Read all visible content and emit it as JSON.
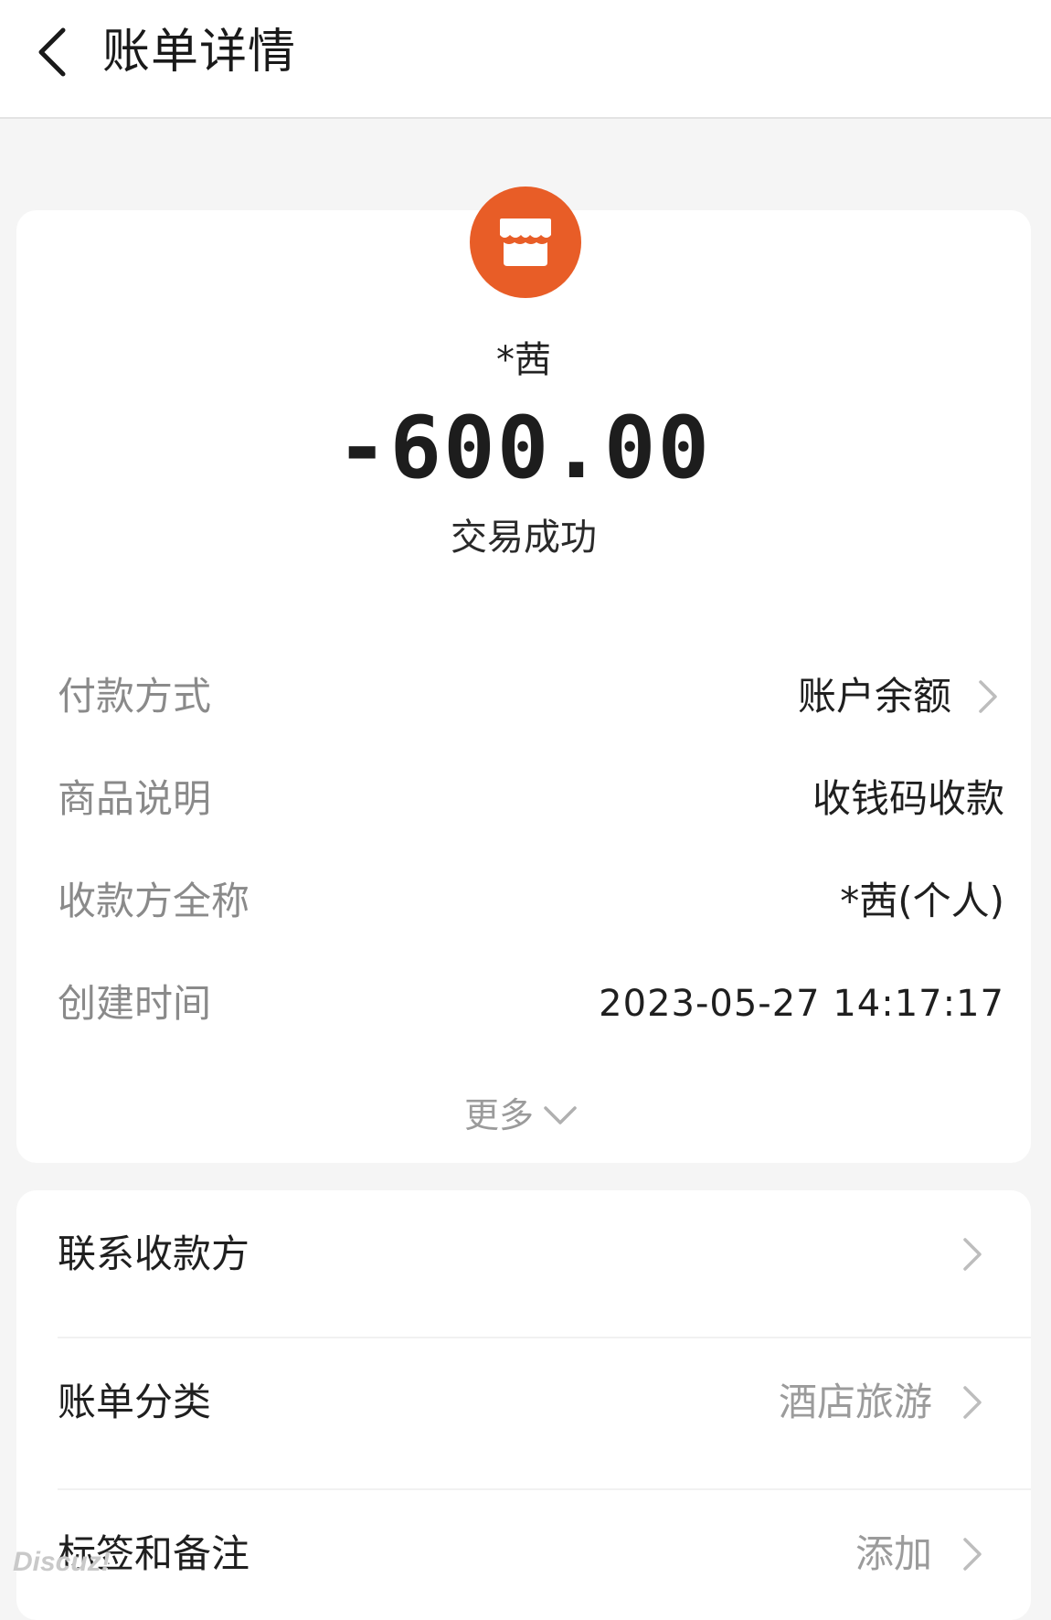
{
  "header": {
    "title": "账单详情"
  },
  "transaction": {
    "counterparty": "*茜",
    "amount": "-600.00",
    "status": "交易成功",
    "avatar_icon": "shop-icon",
    "avatar_color": "#e85d27"
  },
  "details": [
    {
      "label": "付款方式",
      "value": "账户余额",
      "has_chevron": true
    },
    {
      "label": "商品说明",
      "value": "收钱码收款",
      "has_chevron": false
    },
    {
      "label": "收款方全称",
      "value": "*茜(个人)",
      "has_chevron": false
    },
    {
      "label": "创建时间",
      "value": "2023-05-27 14:17:17",
      "has_chevron": false
    }
  ],
  "more": {
    "label": "更多"
  },
  "actions": [
    {
      "label": "联系收款方",
      "value": ""
    },
    {
      "label": "账单分类",
      "value": "酒店旅游"
    },
    {
      "label": "标签和备注",
      "value": "添加"
    }
  ],
  "watermark": "Discuz!"
}
